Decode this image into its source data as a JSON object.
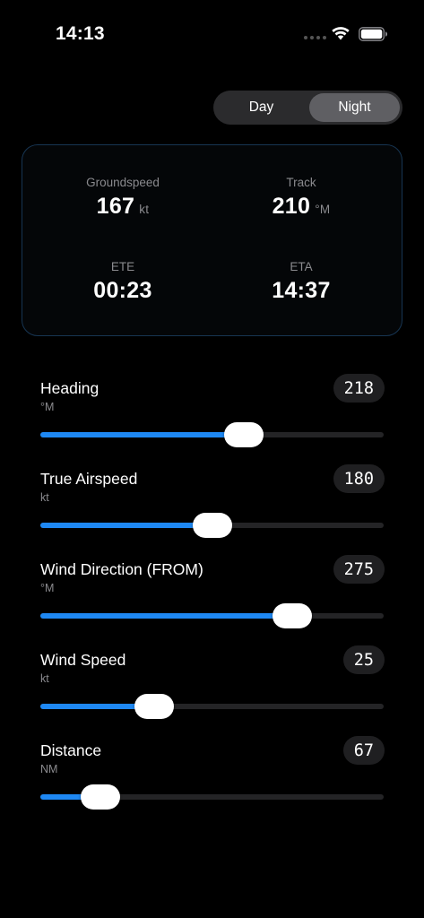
{
  "status_bar": {
    "time": "14:13"
  },
  "mode_toggle": {
    "day_label": "Day",
    "night_label": "Night",
    "selected": "Night"
  },
  "summary": {
    "groundspeed": {
      "label": "Groundspeed",
      "value": "167",
      "unit": "kt"
    },
    "track": {
      "label": "Track",
      "value": "210",
      "unit": "°M"
    },
    "ete": {
      "label": "ETE",
      "value": "00:23"
    },
    "eta": {
      "label": "ETA",
      "value": "14:37"
    }
  },
  "sliders": [
    {
      "title": "Heading",
      "unit": "°M",
      "value": "218",
      "fraction": 0.592
    },
    {
      "title": "True Airspeed",
      "unit": "kt",
      "value": "180",
      "fraction": 0.5
    },
    {
      "title": "Wind Direction (FROM)",
      "unit": "°M",
      "value": "275",
      "fraction": 0.733
    },
    {
      "title": "Wind Speed",
      "unit": "kt",
      "value": "25",
      "fraction": 0.331
    },
    {
      "title": "Distance",
      "unit": "NM",
      "value": "67",
      "fraction": 0.175
    }
  ],
  "colors": {
    "accent": "#1e88f3",
    "background": "#000000",
    "card_border": "#173552"
  }
}
